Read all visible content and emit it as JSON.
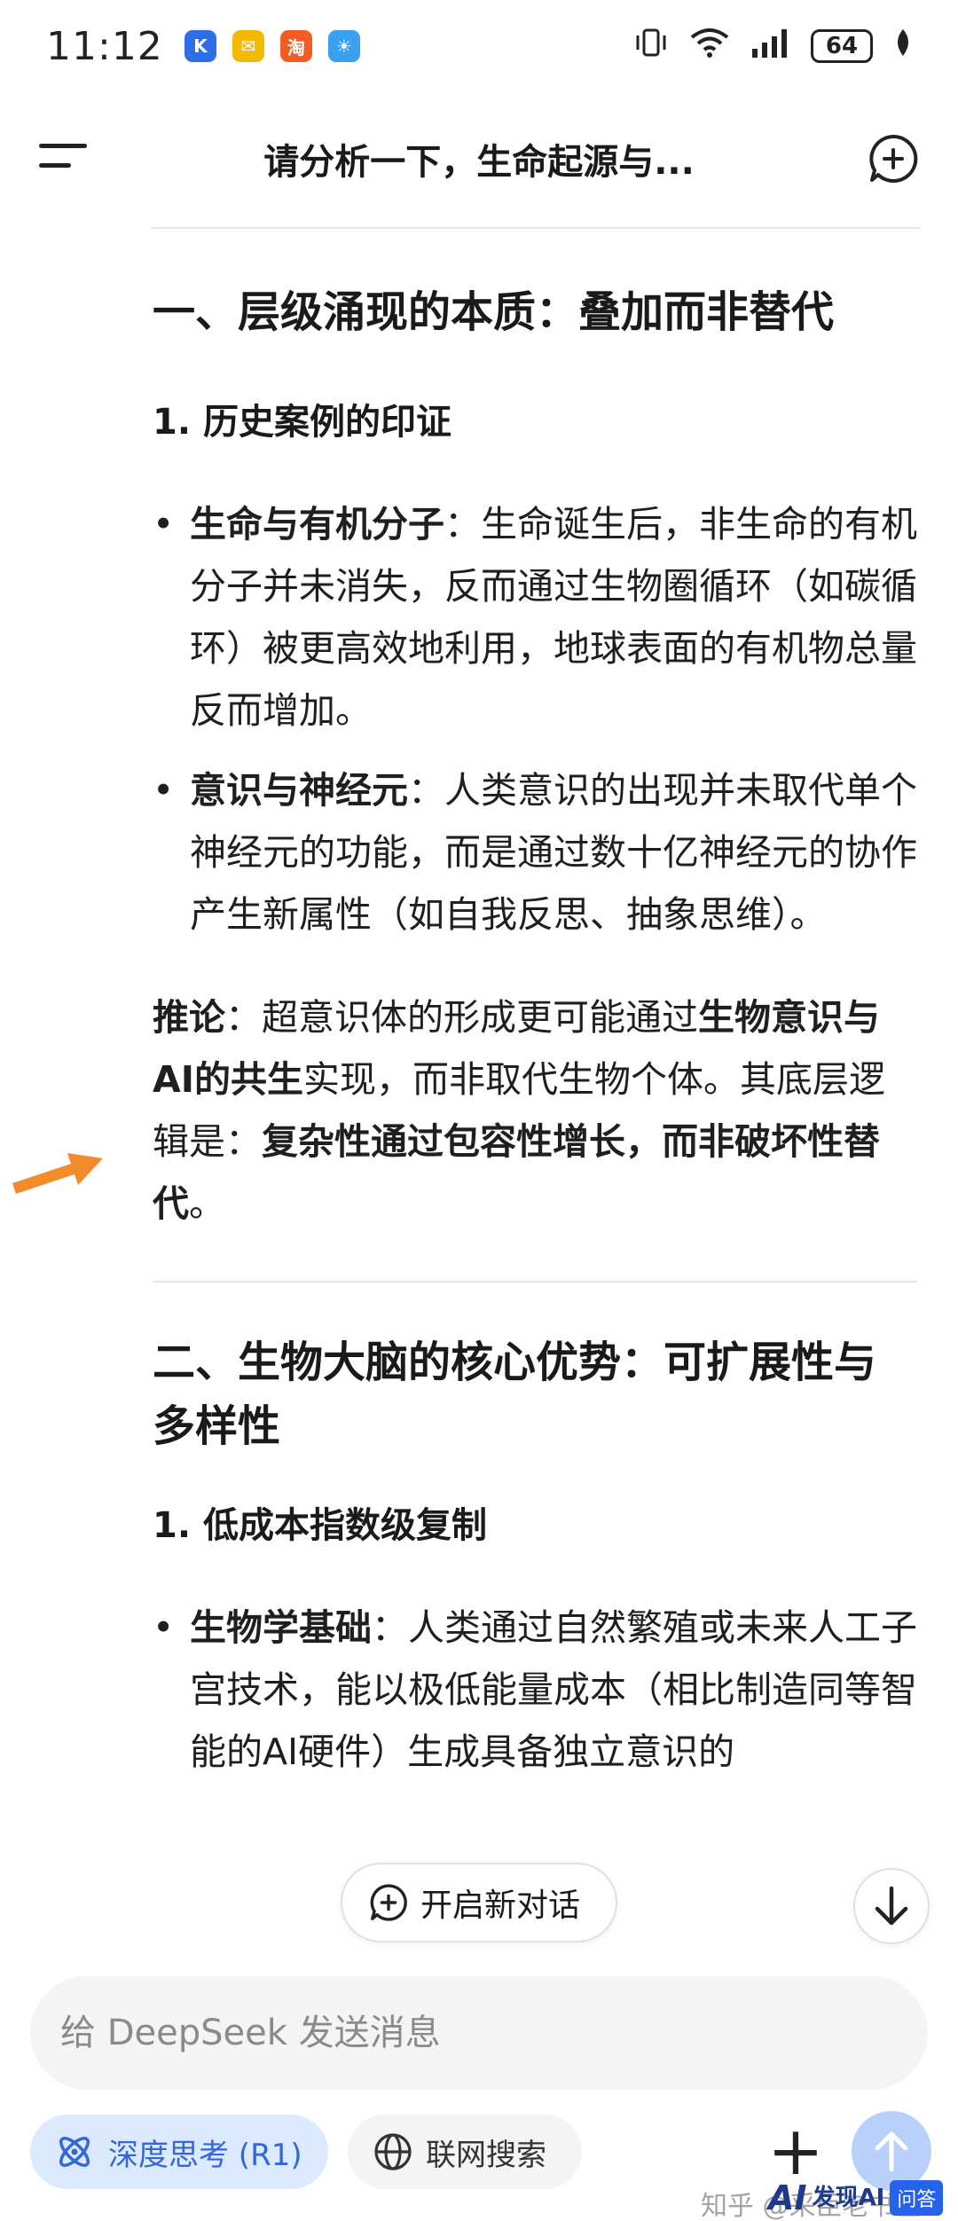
{
  "status_bar": {
    "time": "11:12",
    "battery": "64",
    "apps": [
      {
        "icon": "app-k-icon",
        "color": "#2b6ee8",
        "glyph": "K"
      },
      {
        "icon": "mail-icon",
        "color": "#f5b800",
        "glyph": "✉"
      },
      {
        "icon": "shop-icon",
        "color": "#f25b22",
        "glyph": "淘"
      },
      {
        "icon": "weather-icon",
        "color": "#3aa0f0",
        "glyph": "☀"
      }
    ]
  },
  "header": {
    "title": "请分析一下，生命起源与..."
  },
  "content": {
    "section1_title": "一、层级涌现的本质：叠加而非替代",
    "section1_sub": "1. 历史案例的印证",
    "bullet1_bold": "生命与有机分子",
    "bullet1_text": "：生命诞生后，非生命的有机分子并未消失，反而通过生物圈循环（如碳循环）被更高效地利用，地球表面的有机物总量反而增加。",
    "bullet2_bold": "意识与神经元",
    "bullet2_text": "：人类意识的出现并未取代单个神经元的功能，而是通过数十亿神经元的协作产生新属性（如自我反思、抽象思维）。",
    "inference_bold": "推论",
    "inference_text1": "：超意识体的形成更可能通过",
    "inference_bold2": "生物意识与AI的共生",
    "inference_text2": "实现，而非取代生物个体。其底层逻辑是：",
    "inference_bold3": "复杂性通过包容性增长，而非破坏性替代",
    "inference_text3": "。",
    "section2_title": "二、生物大脑的核心优势：可扩展性与多样性",
    "section2_sub": "1. 低成本指数级复制",
    "bullet3_bold": "生物学基础",
    "bullet3_text": "：人类通过自然繁殖或未来人工子宫技术，能以极低能量成本（相比制造同等智能的AI硬件）生成具备独立意识的"
  },
  "floating": {
    "new_chat_label": "开启新对话"
  },
  "composer": {
    "placeholder": "给 DeepSeek 发送消息",
    "deep_think_label": "深度思考 (R1)",
    "web_search_label": "联网搜索"
  },
  "watermark": {
    "text": "知乎 @采臣老书生",
    "logo_ai": "AI",
    "logo_name": "发现AI",
    "logo_badge": "问答"
  },
  "colors": {
    "accent": "#3566d8",
    "arrow": "#f28c2b",
    "send_button": "#b9d0fb"
  }
}
